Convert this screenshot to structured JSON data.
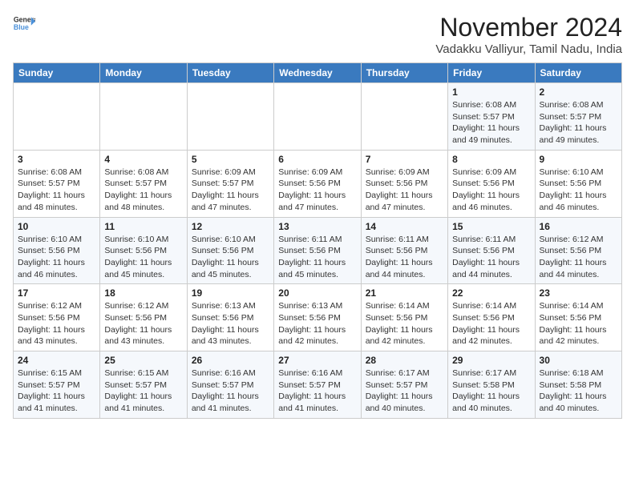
{
  "header": {
    "logo_line1": "General",
    "logo_line2": "Blue",
    "title": "November 2024",
    "subtitle": "Vadakku Valliyur, Tamil Nadu, India"
  },
  "weekdays": [
    "Sunday",
    "Monday",
    "Tuesday",
    "Wednesday",
    "Thursday",
    "Friday",
    "Saturday"
  ],
  "weeks": [
    [
      {
        "day": "",
        "info": ""
      },
      {
        "day": "",
        "info": ""
      },
      {
        "day": "",
        "info": ""
      },
      {
        "day": "",
        "info": ""
      },
      {
        "day": "",
        "info": ""
      },
      {
        "day": "1",
        "info": "Sunrise: 6:08 AM\nSunset: 5:57 PM\nDaylight: 11 hours and 49 minutes."
      },
      {
        "day": "2",
        "info": "Sunrise: 6:08 AM\nSunset: 5:57 PM\nDaylight: 11 hours and 49 minutes."
      }
    ],
    [
      {
        "day": "3",
        "info": "Sunrise: 6:08 AM\nSunset: 5:57 PM\nDaylight: 11 hours and 48 minutes."
      },
      {
        "day": "4",
        "info": "Sunrise: 6:08 AM\nSunset: 5:57 PM\nDaylight: 11 hours and 48 minutes."
      },
      {
        "day": "5",
        "info": "Sunrise: 6:09 AM\nSunset: 5:57 PM\nDaylight: 11 hours and 47 minutes."
      },
      {
        "day": "6",
        "info": "Sunrise: 6:09 AM\nSunset: 5:56 PM\nDaylight: 11 hours and 47 minutes."
      },
      {
        "day": "7",
        "info": "Sunrise: 6:09 AM\nSunset: 5:56 PM\nDaylight: 11 hours and 47 minutes."
      },
      {
        "day": "8",
        "info": "Sunrise: 6:09 AM\nSunset: 5:56 PM\nDaylight: 11 hours and 46 minutes."
      },
      {
        "day": "9",
        "info": "Sunrise: 6:10 AM\nSunset: 5:56 PM\nDaylight: 11 hours and 46 minutes."
      }
    ],
    [
      {
        "day": "10",
        "info": "Sunrise: 6:10 AM\nSunset: 5:56 PM\nDaylight: 11 hours and 46 minutes."
      },
      {
        "day": "11",
        "info": "Sunrise: 6:10 AM\nSunset: 5:56 PM\nDaylight: 11 hours and 45 minutes."
      },
      {
        "day": "12",
        "info": "Sunrise: 6:10 AM\nSunset: 5:56 PM\nDaylight: 11 hours and 45 minutes."
      },
      {
        "day": "13",
        "info": "Sunrise: 6:11 AM\nSunset: 5:56 PM\nDaylight: 11 hours and 45 minutes."
      },
      {
        "day": "14",
        "info": "Sunrise: 6:11 AM\nSunset: 5:56 PM\nDaylight: 11 hours and 44 minutes."
      },
      {
        "day": "15",
        "info": "Sunrise: 6:11 AM\nSunset: 5:56 PM\nDaylight: 11 hours and 44 minutes."
      },
      {
        "day": "16",
        "info": "Sunrise: 6:12 AM\nSunset: 5:56 PM\nDaylight: 11 hours and 44 minutes."
      }
    ],
    [
      {
        "day": "17",
        "info": "Sunrise: 6:12 AM\nSunset: 5:56 PM\nDaylight: 11 hours and 43 minutes."
      },
      {
        "day": "18",
        "info": "Sunrise: 6:12 AM\nSunset: 5:56 PM\nDaylight: 11 hours and 43 minutes."
      },
      {
        "day": "19",
        "info": "Sunrise: 6:13 AM\nSunset: 5:56 PM\nDaylight: 11 hours and 43 minutes."
      },
      {
        "day": "20",
        "info": "Sunrise: 6:13 AM\nSunset: 5:56 PM\nDaylight: 11 hours and 42 minutes."
      },
      {
        "day": "21",
        "info": "Sunrise: 6:14 AM\nSunset: 5:56 PM\nDaylight: 11 hours and 42 minutes."
      },
      {
        "day": "22",
        "info": "Sunrise: 6:14 AM\nSunset: 5:56 PM\nDaylight: 11 hours and 42 minutes."
      },
      {
        "day": "23",
        "info": "Sunrise: 6:14 AM\nSunset: 5:56 PM\nDaylight: 11 hours and 42 minutes."
      }
    ],
    [
      {
        "day": "24",
        "info": "Sunrise: 6:15 AM\nSunset: 5:57 PM\nDaylight: 11 hours and 41 minutes."
      },
      {
        "day": "25",
        "info": "Sunrise: 6:15 AM\nSunset: 5:57 PM\nDaylight: 11 hours and 41 minutes."
      },
      {
        "day": "26",
        "info": "Sunrise: 6:16 AM\nSunset: 5:57 PM\nDaylight: 11 hours and 41 minutes."
      },
      {
        "day": "27",
        "info": "Sunrise: 6:16 AM\nSunset: 5:57 PM\nDaylight: 11 hours and 41 minutes."
      },
      {
        "day": "28",
        "info": "Sunrise: 6:17 AM\nSunset: 5:57 PM\nDaylight: 11 hours and 40 minutes."
      },
      {
        "day": "29",
        "info": "Sunrise: 6:17 AM\nSunset: 5:58 PM\nDaylight: 11 hours and 40 minutes."
      },
      {
        "day": "30",
        "info": "Sunrise: 6:18 AM\nSunset: 5:58 PM\nDaylight: 11 hours and 40 minutes."
      }
    ]
  ]
}
